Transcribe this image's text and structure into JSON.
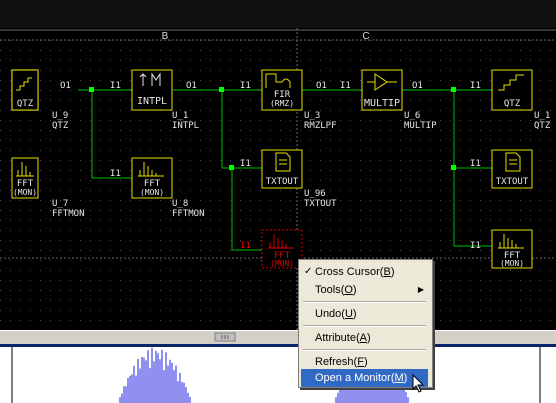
{
  "columns": [
    "B",
    "C"
  ],
  "blocks": [
    {
      "name": "U_9",
      "type": "QTZ",
      "icon": "quantizer-icon",
      "label": "QTZ",
      "in_port": "",
      "out_port": "O1"
    },
    {
      "name": "U_1",
      "type": "INTPL",
      "icon": "interpolator-icon",
      "label": "INTPL",
      "in_port": "I1",
      "out_port": "O1"
    },
    {
      "name": "U_3",
      "type": "RMZLPF",
      "icon": "fir-filter-icon",
      "label": "FIR",
      "sublabel": "(RMZ)",
      "in_port": "I1",
      "out_port": "O1"
    },
    {
      "name": "U_6",
      "type": "MULTIP",
      "icon": "multiplier-icon",
      "label": "MULTIP",
      "in_port": "I1",
      "out_port": "O1"
    },
    {
      "name": "U_1",
      "type": "QTZ",
      "icon": "quantizer-icon",
      "label": "QTZ",
      "in_port": "I1",
      "out_port": ""
    },
    {
      "name": "U_7",
      "type": "FFTMON",
      "icon": "fft-monitor-icon",
      "label": "FFT",
      "sublabel": "(MON)",
      "in_port": "",
      "out_port": ""
    },
    {
      "name": "U_8",
      "type": "FFTMON",
      "icon": "fft-monitor-icon",
      "label": "FFT",
      "sublabel": "(MON)",
      "in_port": "I1",
      "out_port": ""
    },
    {
      "name": "U_96",
      "type": "TXTOUT",
      "icon": "text-output-icon",
      "label": "TXTOUT",
      "in_port": "I1",
      "out_port": ""
    },
    {
      "name": "",
      "type": "TXTOUT",
      "icon": "text-output-icon",
      "label": "TXTOUT",
      "in_port": "I1",
      "out_port": ""
    },
    {
      "name": "",
      "type": "",
      "icon": "fft-monitor-icon",
      "label": "FFT",
      "sublabel": "(MON)",
      "in_port": "I1",
      "out_port": "",
      "selected": true
    },
    {
      "name": "",
      "type": "",
      "icon": "fft-monitor-icon",
      "label": "FFT",
      "sublabel": "(MON)",
      "in_port": "I1",
      "out_port": ""
    }
  ],
  "context_menu": {
    "items": [
      {
        "label": "Cross Cursor",
        "key": "B",
        "checked": true
      },
      {
        "label": "Tools",
        "key": "O",
        "submenu": true
      },
      {
        "label": "Undo",
        "key": "U"
      },
      {
        "label": "Attribute",
        "key": "A"
      },
      {
        "label": "Refresh",
        "key": "F"
      },
      {
        "label": "Open a Monitor",
        "key": "M",
        "highlighted": true
      }
    ]
  },
  "colors": {
    "background": "#000000",
    "wire": "#00c000",
    "block": "#e8e000",
    "block_text": "#e8e8e8",
    "selected_block": "#e00000",
    "grid": "#4a4a4a",
    "menu_bg": "#ece9d8",
    "menu_highlight": "#316ac5",
    "waveform": "#2020e0"
  }
}
